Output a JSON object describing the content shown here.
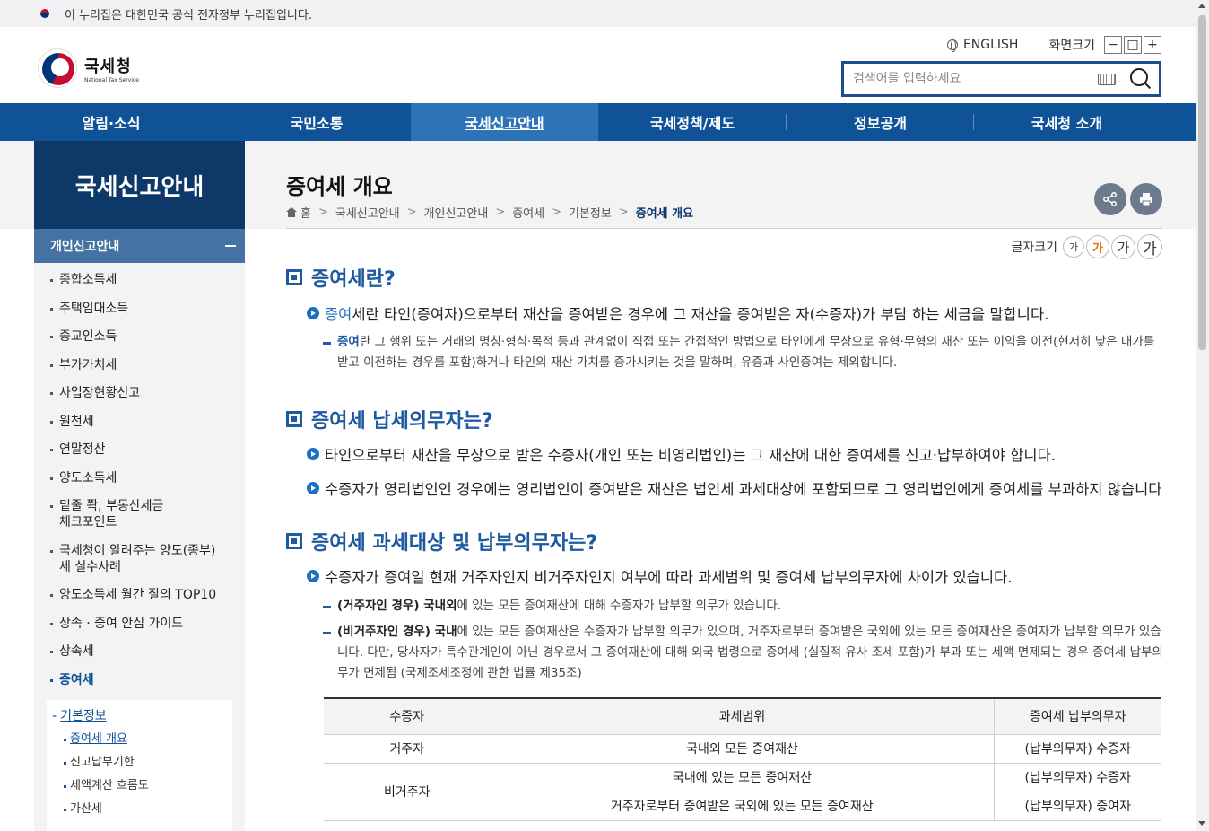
{
  "gov_banner": {
    "text": "이 누리집은 대한민국 공식 전자정부 누리집입니다."
  },
  "header": {
    "logo_ko": "국세청",
    "logo_en": "National Tax Service",
    "english_label": "ENGLISH",
    "zoom_label": "화면크기",
    "zoom_buttons": [
      "−",
      "□",
      "+"
    ],
    "search_placeholder": "검색어를 입력하세요"
  },
  "gnb": [
    "알림·소식",
    "국민소통",
    "국세신고안내",
    "국세정책/제도",
    "정보공개",
    "국세청 소개"
  ],
  "sidebar": {
    "title": "국세신고안내",
    "section": "개인신고안내",
    "items": [
      "종합소득세",
      "주택임대소득",
      "종교인소득",
      "부가가치세",
      "사업장현황신고",
      "원천세",
      "연말정산",
      "양도소득세",
      "밑줄 쫙, 부동산세금\n체크포인트",
      "국세청이 알려주는 양도(종부)\n세 실수사례",
      "양도소득세 월간 질의 TOP10",
      "상속 · 증여 안심 가이드",
      "상속세",
      "증여세"
    ],
    "sub_head": "기본정보",
    "sub_items": [
      "증여세 개요",
      "신고납부기한",
      "세액계산 흐름도",
      "가산세"
    ]
  },
  "content": {
    "title": "증여세 개요",
    "breadcrumb": [
      "홈",
      "국세신고안내",
      "개인신고안내",
      "증여세",
      "기본정보",
      "증여세 개요"
    ],
    "fontsize_label": "글자크기",
    "fontsize_options": [
      "가",
      "가",
      "가",
      "가"
    ],
    "s1_title": "증여세란?",
    "s1_b1_hl": "증여",
    "s1_b1": "세란 타인(증여자)으로부터 재산을 증여받은 경우에 그 재산을 증여받은 자(수증자)가 부담 하는 세금을 말합니다.",
    "s1_sub_b": "증여",
    "s1_sub": "란 그 행위 또는 거래의 명칭·형식·목적 등과 관계없이 직접 또는 간접적인 방법으로 타인에게 무상으로 유형·무형의 재산 또는 이익을 이전(현저히 낮은 대가를 받고 이전하는 경우를 포함)하거나 타인의 재산 가치를 증가시키는 것을 말하며, 유증과 사인증여는 제외합니다.",
    "s2_title": "증여세 납세의무자는?",
    "s2_b1": "타인으로부터 재산을 무상으로 받은 수증자(개인 또는 비영리법인)는 그 재산에 대한 증여세를 신고·납부하여야 합니다.",
    "s2_b2": "수증자가 영리법인인 경우에는 영리법인이 증여받은 재산은 법인세 과세대상에 포함되므로 그 영리법인에게 증여세를 부과하지 않습니다",
    "s3_title": "증여세 과세대상 및 납부의무자는?",
    "s3_b1": "수증자가 증여일 현재 거주자인지 비거주자인지 여부에 따라 과세범위 및 증여세 납부의무자에 차이가 있습니다.",
    "s3_sub1_b": "(거주자인 경우) 국내외",
    "s3_sub1": "에 있는 모든 증여재산에 대해 수증자가 납부할 의무가 있습니다.",
    "s3_sub2_b": "(비거주자인 경우) 국내",
    "s3_sub2": "에 있는 모든 증여재산은 수증자가 납부할 의무가 있으며, 거주자로부터 증여받은 국외에 있는 모든 증여재산은 증여자가 납부할 의무가 있습니다. 다만, 당사자가 특수관계인이 아닌 경우로서 그 증여재산에 대해 외국 법령으로 증여세 (실질적 유사 조세 포함)가 부과 또는 세액 면제되는 경우 증여세 납부의무가 면제됨 (국제조세조정에 관한 법률 제35조)",
    "table": {
      "headers": [
        "수증자",
        "과세범위",
        "증여세 납부의무자"
      ],
      "r1": [
        "거주자",
        "국내외 모든 증여재산",
        "(납부의무자) 수증자"
      ],
      "r2": [
        "비거주자",
        "국내에 있는 모든 증여재산",
        "(납부의무자) 수증자"
      ],
      "r3": [
        "거주자로부터 증여받은 국외에 있는 모든 증여재산",
        "(납부의무자) 증여자"
      ]
    }
  }
}
